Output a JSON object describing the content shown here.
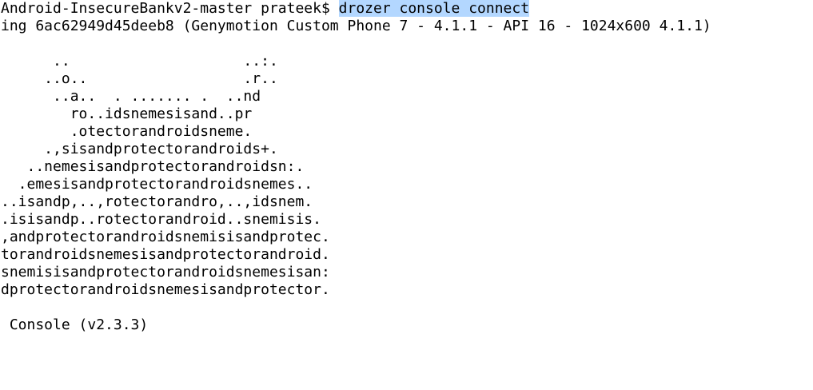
{
  "terminal": {
    "prompt": "Android-InsecureBankv2-master prateek$ ",
    "command": "drozer console connect",
    "selection_color": "#b3d7ff",
    "output_lines": [
      "ing 6ac62949d45deeb8 (Genymotion Custom Phone 7 - 4.1.1 - API 16 - 1024x600 4.1.1)",
      "",
      "      ..                    ..:.",
      "     ..o..                  .r..",
      "      ..a..  . ....... .  ..nd",
      "        ro..idsnemesisand..pr",
      "        .otectorandroidsneme.",
      "     .,sisandprotectorandroids+.",
      "   ..nemesisandprotectorandroidsn:.",
      "  .emesisandprotectorandroidsnemes..",
      "..isandp,..,rotectorandro,..,idsnem.",
      ".isisandp..rotectorandroid..snemisis.",
      ",andprotectorandroidsnemisisandprotec.",
      "torandroidsnemesisandprotectorandroid.",
      "snemisisandprotectorandroidsnemesisan:",
      "dprotectorandroidsnemesisandprotector.",
      "",
      " Console (v2.3.3)"
    ]
  }
}
